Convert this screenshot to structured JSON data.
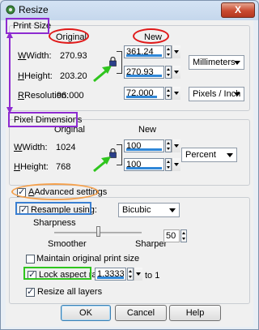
{
  "window": {
    "title": "Resize",
    "close_glyph": "X"
  },
  "print_size": {
    "group_label": "Print Size",
    "original_header": "Original",
    "new_header": "New",
    "width_label": "Width:",
    "width_original": "270.93",
    "width_new": "361.24",
    "height_label": "Height:",
    "height_original": "203.20",
    "height_new": "270.93",
    "resolution_label": "Resolution:",
    "resolution_original": "96.000",
    "resolution_new": "72.000",
    "units": "Millimeters",
    "resolution_units": "Pixels / Inch"
  },
  "pixel_dimensions": {
    "group_label": "Pixel Dimensions",
    "original_header": "Original",
    "new_header": "New",
    "width_label": "Width:",
    "width_original": "1024",
    "width_new": "100",
    "height_label": "Height:",
    "height_original": "768",
    "height_new": "100",
    "units": "Percent"
  },
  "advanced": {
    "label": "Advanced settings",
    "checked": true,
    "resample_label": "Resample using:",
    "resample_checked": true,
    "resample_method": "Bicubic",
    "sharpness_label": "Sharpness",
    "smoother_label": "Smoother",
    "sharper_label": "Sharper",
    "sharpness_value": "50",
    "sharpness_fraction": 0.5,
    "maintain_print_label": "Maintain original print size",
    "maintain_print_checked": false,
    "lock_aspect_label": "Lock aspect ratio:",
    "lock_aspect_checked": true,
    "aspect_value": "1.3333",
    "to_one_label": "to 1",
    "resize_layers_label": "Resize all layers",
    "resize_layers_checked": true
  },
  "buttons": {
    "ok": "OK",
    "cancel": "Cancel",
    "help": "Help"
  },
  "colors": {
    "annotation_purple": "#8d2bd1",
    "annotation_red": "#e01919",
    "annotation_green": "#2fc51e",
    "annotation_orange": "#f4a04c",
    "annotation_blue": "#3a7fd1",
    "progress_blue": "#2f87d8"
  }
}
